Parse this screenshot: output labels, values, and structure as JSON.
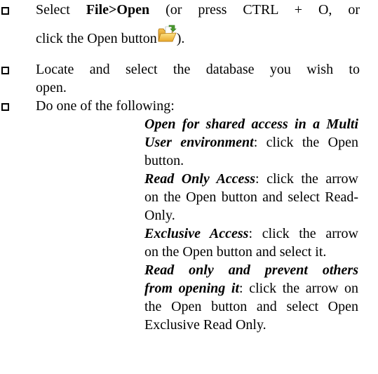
{
  "step1": {
    "prefix": "Select ",
    "menu_path": "File>Open",
    "suffix_line1": " (or press CTRL + O, or",
    "line2": "click the Open button",
    "line2_end": ")."
  },
  "step2": {
    "line1": "Locate and select the database you wish to",
    "line2": "open."
  },
  "step3": {
    "text": "Do one of the following:"
  },
  "options": [
    {
      "title_l1": "Open for shared access in a Multi",
      "title_l2": "User environment",
      "desc_l2": ":  click the Open",
      "desc_l3": "button."
    },
    {
      "title": "Read Only Access",
      "desc_l1": ":  click the arrow",
      "desc_l2": "on the Open button and select Read-",
      "desc_l3": "Only."
    },
    {
      "title": "Exclusive Access",
      "desc_l1": ":  click the arrow",
      "desc_l2": "on the Open button and select it."
    },
    {
      "title_l1": "Read only and prevent others",
      "title_l2": "from opening it",
      "desc_l2": ":  click the arrow on",
      "desc_l3": "the Open button and select Open",
      "desc_l4": "Exclusive Read Only."
    }
  ],
  "icons": {
    "open_button": "open-folder-icon"
  }
}
